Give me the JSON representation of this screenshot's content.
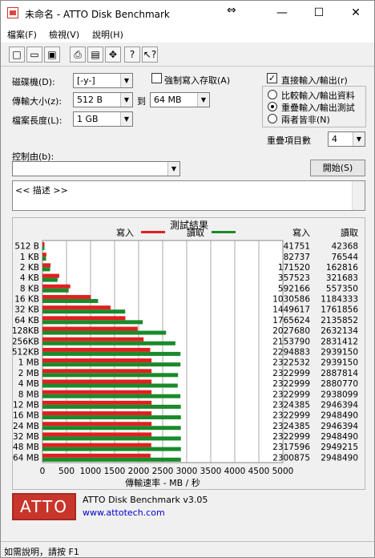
{
  "window": {
    "title": "未命名 - ATTO Disk Benchmark",
    "minimize": "—",
    "maximize": "☐",
    "close": "✕"
  },
  "menu": [
    "檔案(F)",
    "檢視(V)",
    "說明(H)"
  ],
  "toolbar": [
    "new-icon",
    "open-icon",
    "save-icon",
    "print-icon",
    "print-preview-icon",
    "move-icon",
    "help-icon",
    "context-help-icon"
  ],
  "form": {
    "drive_label": "磁碟機(D):",
    "drive_value": "[-y-]",
    "force_write_label": "強制寫入存取(A)",
    "force_write_checked": false,
    "transfer_label": "傳輸大小(z):",
    "transfer_from": "512 B",
    "transfer_to_label": "到",
    "transfer_to": "64 MB",
    "file_length_label": "檔案長度(L):",
    "file_length": "1 GB",
    "direct_io_label": "直接輸入/輸出(r)",
    "direct_io_checked": true,
    "radio_compare": "比較輸入/輸出資料",
    "radio_overlap": "重疊輸入/輸出測試",
    "radio_neither": "兩者皆非(N)",
    "queue_label": "重疊項目數",
    "queue_value": "4",
    "controlled_by_label": "控制由(b):",
    "controlled_by_value": "",
    "start_button": "開始(S)",
    "description": "<< 描述 >>"
  },
  "chart_data": {
    "type": "bar",
    "title": "測試結果",
    "legend": [
      {
        "name": "寫入",
        "color": "#e02020"
      },
      {
        "name": "讀取",
        "color": "#1a8a2a"
      }
    ],
    "legend_placement": "top",
    "xlabel": "傳輸速率 - MB / 秒",
    "xlim": [
      0,
      5000
    ],
    "xticks": [
      0,
      500,
      1000,
      1500,
      2000,
      2500,
      3000,
      3500,
      4000,
      4500,
      5000
    ],
    "grid": true,
    "categories": [
      "512 B",
      "1 KB",
      "2 KB",
      "4 KB",
      "8 KB",
      "16 KB",
      "32 KB",
      "64 KB",
      "128KB",
      "256KB",
      "512KB",
      "1 MB",
      "2 MB",
      "4 MB",
      "8 MB",
      "12 MB",
      "16 MB",
      "24 MB",
      "32 MB",
      "48 MB",
      "64 MB"
    ],
    "series": [
      {
        "name": "寫入",
        "values": [
          41751,
          82737,
          171520,
          357523,
          592166,
          1030586,
          1449617,
          1765624,
          2027680,
          2153790,
          2294883,
          2322532,
          2322999,
          2322999,
          2322999,
          2324385,
          2322999,
          2324385,
          2322999,
          2317596,
          2300875
        ]
      },
      {
        "name": "讀取",
        "values": [
          42368,
          76544,
          162816,
          321683,
          557350,
          1184333,
          1761856,
          2135852,
          2632134,
          2831412,
          2939150,
          2939150,
          2887814,
          2880770,
          2938099,
          2946394,
          2948490,
          2946394,
          2948490,
          2949215,
          2948490
        ]
      }
    ],
    "table_headers": [
      "寫入",
      "讀取"
    ]
  },
  "footer": {
    "product": "ATTO Disk Benchmark v3.05",
    "url": "www.attotech.com",
    "logo_text": "ATTO"
  },
  "status": "如需說明，請按 F1",
  "colors": {
    "write": "#e02020",
    "read": "#1a8a2a",
    "link": "#0000cc",
    "logo": "#c8362b"
  }
}
